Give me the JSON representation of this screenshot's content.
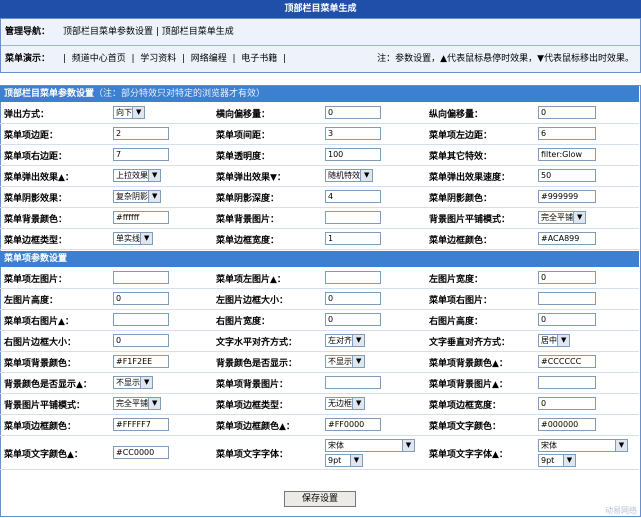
{
  "title": "顶部栏目菜单生成",
  "nav": {
    "label1": "管理导航：",
    "links1": [
      "顶部栏目菜单参数设置",
      "顶部栏目菜单生成"
    ],
    "label2": "菜单演示：",
    "links2": [
      "频道中心首页",
      "学习资料",
      "网络编程",
      "电子书籍"
    ],
    "note": "注：参数设置，▲代表鼠标悬停时效果，▼代表鼠标移出时效果。"
  },
  "section1": {
    "title": "顶部栏目菜单参数设置",
    "subtitle": "（注：部分特效只对特定的浏览器才有效）"
  },
  "section2": {
    "title": "菜单项参数设置"
  },
  "rows1": [
    [
      {
        "l": "弹出方式：",
        "t": "sel",
        "v": "向下"
      },
      {
        "l": "横向偏移量：",
        "t": "in",
        "v": "0"
      },
      {
        "l": "纵向偏移量：",
        "t": "in",
        "v": "0"
      }
    ],
    [
      {
        "l": "菜单项边距：",
        "t": "in",
        "v": "2"
      },
      {
        "l": "菜单项间距：",
        "t": "in",
        "v": "3"
      },
      {
        "l": "菜单项左边距：",
        "t": "in",
        "v": "6"
      }
    ],
    [
      {
        "l": "菜单项右边距：",
        "t": "in",
        "v": "7"
      },
      {
        "l": "菜单透明度：",
        "t": "in",
        "v": "100"
      },
      {
        "l": "菜单其它特效：",
        "t": "in",
        "v": "filter:Glow"
      }
    ],
    [
      {
        "l": "菜单弹出效果▲：",
        "t": "sel",
        "v": "上拉效果"
      },
      {
        "l": "菜单弹出效果▼：",
        "t": "sel",
        "v": "随机特效"
      },
      {
        "l": "菜单弹出效果速度：",
        "t": "in",
        "v": "50"
      }
    ],
    [
      {
        "l": "菜单阴影效果：",
        "t": "sel",
        "v": "复杂阴影"
      },
      {
        "l": "菜单阴影深度：",
        "t": "in",
        "v": "4"
      },
      {
        "l": "菜单阴影颜色：",
        "t": "in",
        "v": "#999999"
      }
    ],
    [
      {
        "l": "菜单背景颜色：",
        "t": "in",
        "v": "#ffffff"
      },
      {
        "l": "菜单背景图片：",
        "t": "in",
        "v": ""
      },
      {
        "l": "背景图片平铺模式：",
        "t": "sel",
        "v": "完全平铺"
      }
    ],
    [
      {
        "l": "菜单边框类型：",
        "t": "sel",
        "v": "单实线"
      },
      {
        "l": "菜单边框宽度：",
        "t": "in",
        "v": "1"
      },
      {
        "l": "菜单边框颜色：",
        "t": "in",
        "v": "#ACA899"
      }
    ]
  ],
  "rows2": [
    [
      {
        "l": "菜单项左图片：",
        "t": "in",
        "v": ""
      },
      {
        "l": "菜单项左图片▲：",
        "t": "in",
        "v": ""
      },
      {
        "l": "左图片宽度：",
        "t": "in",
        "v": "0"
      }
    ],
    [
      {
        "l": "左图片高度：",
        "t": "in",
        "v": "0"
      },
      {
        "l": "左图片边框大小：",
        "t": "in",
        "v": "0"
      },
      {
        "l": "菜单项右图片：",
        "t": "in",
        "v": ""
      }
    ],
    [
      {
        "l": "菜单项右图片▲：",
        "t": "in",
        "v": ""
      },
      {
        "l": "右图片宽度：",
        "t": "in",
        "v": "0"
      },
      {
        "l": "右图片高度：",
        "t": "in",
        "v": "0"
      }
    ],
    [
      {
        "l": "右图片边框大小：",
        "t": "in",
        "v": "0"
      },
      {
        "l": "文字水平对齐方式：",
        "t": "sel",
        "v": "左对齐"
      },
      {
        "l": "文字垂直对齐方式：",
        "t": "sel",
        "v": "居中"
      }
    ],
    [
      {
        "l": "菜单项背景颜色：",
        "t": "in",
        "v": "#F1F2EE"
      },
      {
        "l": "背景颜色是否显示：",
        "t": "sel",
        "v": "不显示"
      },
      {
        "l": "菜单项背景颜色▲：",
        "t": "in",
        "v": "#CCCCCC"
      }
    ],
    [
      {
        "l": "背景颜色是否显示▲：",
        "t": "sel",
        "v": "不显示"
      },
      {
        "l": "菜单项背景图片：",
        "t": "in",
        "v": ""
      },
      {
        "l": "菜单项背景图片▲：",
        "t": "in",
        "v": ""
      }
    ],
    [
      {
        "l": "背景图片平铺模式：",
        "t": "sel",
        "v": "完全平铺"
      },
      {
        "l": "菜单项边框类型：",
        "t": "sel",
        "v": "无边框"
      },
      {
        "l": "菜单项边框宽度：",
        "t": "in",
        "v": "0"
      }
    ],
    [
      {
        "l": "菜单项边框颜色：",
        "t": "in",
        "v": "#FFFFF7"
      },
      {
        "l": "菜单项边框颜色▲：",
        "t": "in",
        "v": "#FF0000"
      },
      {
        "l": "菜单项文字颜色：",
        "t": "in",
        "v": "#000000"
      }
    ],
    [
      {
        "l": "菜单项文字颜色▲：",
        "t": "in",
        "v": "#CC0000"
      },
      {
        "l": "菜单项文字字体：",
        "t": "font",
        "v": "宋体",
        "v2": "9pt"
      },
      {
        "l": "菜单项文字字体▲：",
        "t": "font",
        "v": "宋体",
        "v2": "9pt"
      }
    ]
  ],
  "save_label": "保存设置",
  "watermark": "动易网络"
}
